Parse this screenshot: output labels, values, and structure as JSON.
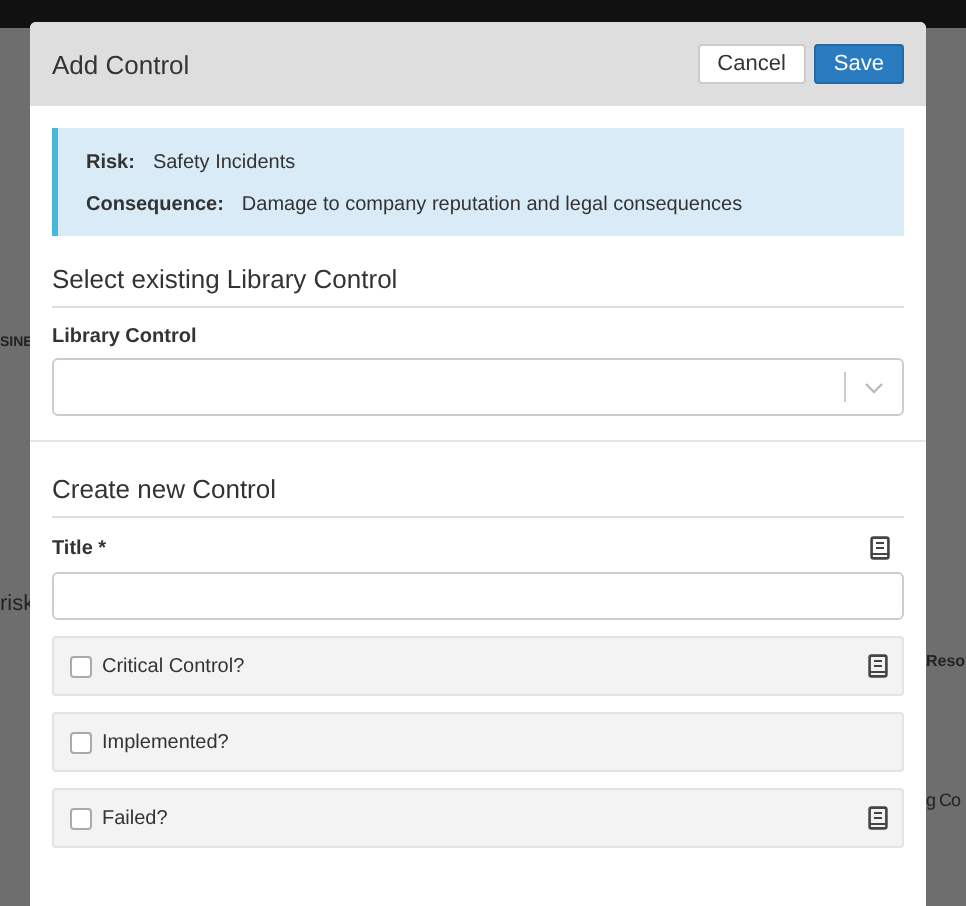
{
  "background": [
    {
      "text": "SINE",
      "kind": "left-top"
    },
    {
      "text": "risk",
      "kind": "left"
    },
    {
      "text": "Reso",
      "kind": "right-top"
    },
    {
      "text": "g Co",
      "kind": "right"
    }
  ],
  "dialog": {
    "title": "Add Control",
    "buttons": [
      {
        "label": "Cancel",
        "kind": "secondary"
      },
      {
        "label": "Save",
        "kind": "primary"
      }
    ]
  },
  "info": [
    {
      "label": "Risk:",
      "value": "Safety Incidents"
    },
    {
      "label": "Consequence:",
      "value": "Damage to company reputation and legal consequences"
    }
  ],
  "library_section": {
    "heading": "Select existing Library Control",
    "field_label": "Library Control"
  },
  "create_section": {
    "heading": "Create new Control",
    "title_label": "Title *",
    "checkboxes": [
      {
        "label": "Critical Control?",
        "checked": false,
        "has_guide": true
      },
      {
        "label": "Implemented?",
        "checked": false,
        "has_guide": false
      },
      {
        "label": "Failed?",
        "checked": false,
        "has_guide": true
      }
    ]
  }
}
